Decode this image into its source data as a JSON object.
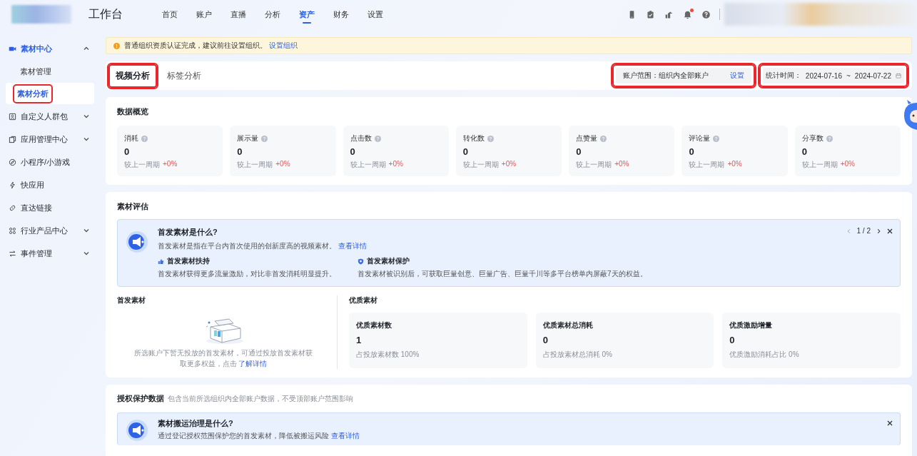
{
  "topbar": {
    "title": "工作台",
    "nav": [
      {
        "label": "首页",
        "selected": false
      },
      {
        "label": "账户",
        "selected": false
      },
      {
        "label": "直播",
        "selected": false
      },
      {
        "label": "分析",
        "selected": false
      },
      {
        "label": "资产",
        "selected": true
      },
      {
        "label": "财务",
        "selected": false
      },
      {
        "label": "设置",
        "selected": false
      }
    ],
    "icons": [
      {
        "badge": false
      },
      {
        "badge": false
      },
      {
        "badge": false
      },
      {
        "badge": true
      },
      {
        "badge": false
      }
    ]
  },
  "sidebar": {
    "items": [
      {
        "kind": "group",
        "label": "素材中心",
        "selected": true,
        "expanded": true,
        "children": [
          {
            "label": "素材管理",
            "selected": false,
            "highlighted": false
          },
          {
            "label": "素材分析",
            "selected": true,
            "highlighted": true
          }
        ]
      },
      {
        "kind": "group",
        "label": "自定义人群包",
        "selected": false,
        "expanded": false
      },
      {
        "kind": "group",
        "label": "应用管理中心",
        "selected": false,
        "expanded": false
      },
      {
        "kind": "link",
        "label": "小程序/小游戏",
        "selected": false
      },
      {
        "kind": "link",
        "label": "快应用",
        "selected": false
      },
      {
        "kind": "link",
        "label": "直达链接",
        "selected": false
      },
      {
        "kind": "group",
        "label": "行业产品中心",
        "selected": false,
        "expanded": false
      },
      {
        "kind": "group",
        "label": "事件管理",
        "selected": false,
        "expanded": false
      }
    ]
  },
  "notice": {
    "text": "普通组织资质认证完成，建议前往设置组织。",
    "link": "设置组织"
  },
  "tabs": [
    {
      "label": "视频分析",
      "selected": true,
      "highlighted": true
    },
    {
      "label": "标签分析",
      "selected": false,
      "highlighted": false
    }
  ],
  "account_scope": {
    "label": "账户范围：组织内全部账户",
    "link": "设置",
    "highlighted": true
  },
  "date_range": {
    "label": "统计时间：",
    "start": "2024-07-16",
    "separator": "~",
    "end": "2024-07-22",
    "highlighted": true
  },
  "overview": {
    "title": "数据概览",
    "metrics": [
      {
        "label": "消耗",
        "value": "0",
        "compare_label": "较上一周期",
        "change": "+0%"
      },
      {
        "label": "展示量",
        "value": "0",
        "compare_label": "较上一周期",
        "change": "+0%"
      },
      {
        "label": "点击数",
        "value": "0",
        "compare_label": "较上一周期",
        "change": "+0%"
      },
      {
        "label": "转化数",
        "value": "0",
        "compare_label": "较上一周期",
        "change": "+0%"
      },
      {
        "label": "点赞量",
        "value": "0",
        "compare_label": "较上一周期",
        "change": "+0%"
      },
      {
        "label": "评论量",
        "value": "0",
        "compare_label": "较上一周期",
        "change": "+0%"
      },
      {
        "label": "分享数",
        "value": "0",
        "compare_label": "较上一周期",
        "change": "+0%"
      }
    ]
  },
  "evaluation": {
    "title": "素材评估",
    "banner": {
      "title": "首发素材是什么?",
      "text": "首发素材是指在平台内首次使用的创新度高的视频素材。",
      "link": "查看详情",
      "pager": "1 / 2",
      "features": [
        {
          "title": "首发素材扶持",
          "text": "首发素材获得更多流量激励，对比非首发消耗明显提升。"
        },
        {
          "title": "首发素材保护",
          "text": "首发素材被识别后，可获取巨量创意、巨量广告、巨量千川等多平台榜单内屏蔽7天的权益。"
        }
      ]
    },
    "first_material": {
      "title": "首发素材",
      "empty_text": "所选账户下暂无投放的首发素材，可通过投放首发素材获取更多权益，点击",
      "link": "了解详情"
    },
    "quality_material": {
      "title": "优质素材",
      "metrics": [
        {
          "label": "优质素材数",
          "value": "1",
          "note": "占投放素材数 100%"
        },
        {
          "label": "优质素材总消耗",
          "value": "0",
          "note": "占投放素材总消耗 0%"
        },
        {
          "label": "优质激励增量",
          "value": "0",
          "note": "优质激励消耗占比 0%"
        }
      ]
    }
  },
  "authorization": {
    "title": "授权保护数据",
    "subtitle": "包含当前所选组织内全部账户数据，不受顶部账户范围影响",
    "banner": {
      "title": "素材搬运治理是什么?",
      "text": "通过登记授权范围保护您的首发素材，降低被搬运风险",
      "link": "查看详情"
    }
  }
}
